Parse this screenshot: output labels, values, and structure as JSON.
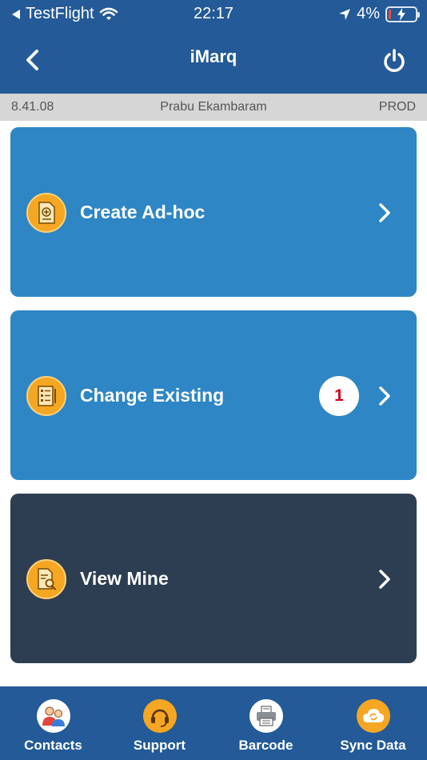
{
  "status_bar": {
    "carrier": "TestFlight",
    "time": "22:17",
    "battery": "4%"
  },
  "header": {
    "title": "iMarq"
  },
  "info": {
    "version": "8.41.08",
    "user": "Prabu Ekambaram",
    "environment": "PROD"
  },
  "cards": [
    {
      "label": "Create Ad-hoc",
      "icon": "add-document-icon"
    },
    {
      "label": "Change Existing",
      "icon": "checklist-icon",
      "badge": "1"
    },
    {
      "label": "View Mine",
      "icon": "document-search-icon"
    }
  ],
  "tabs": [
    {
      "label": "Contacts",
      "icon": "contacts-icon"
    },
    {
      "label": "Support",
      "icon": "headset-icon"
    },
    {
      "label": "Barcode",
      "icon": "printer-icon"
    },
    {
      "label": "Sync Data",
      "icon": "cloud-sync-icon"
    }
  ],
  "colors": {
    "header": "#235a97",
    "card_blue": "#2e86c5",
    "card_dark": "#2d3e52",
    "accent": "#f5a623",
    "badge_text": "#d0021b"
  }
}
